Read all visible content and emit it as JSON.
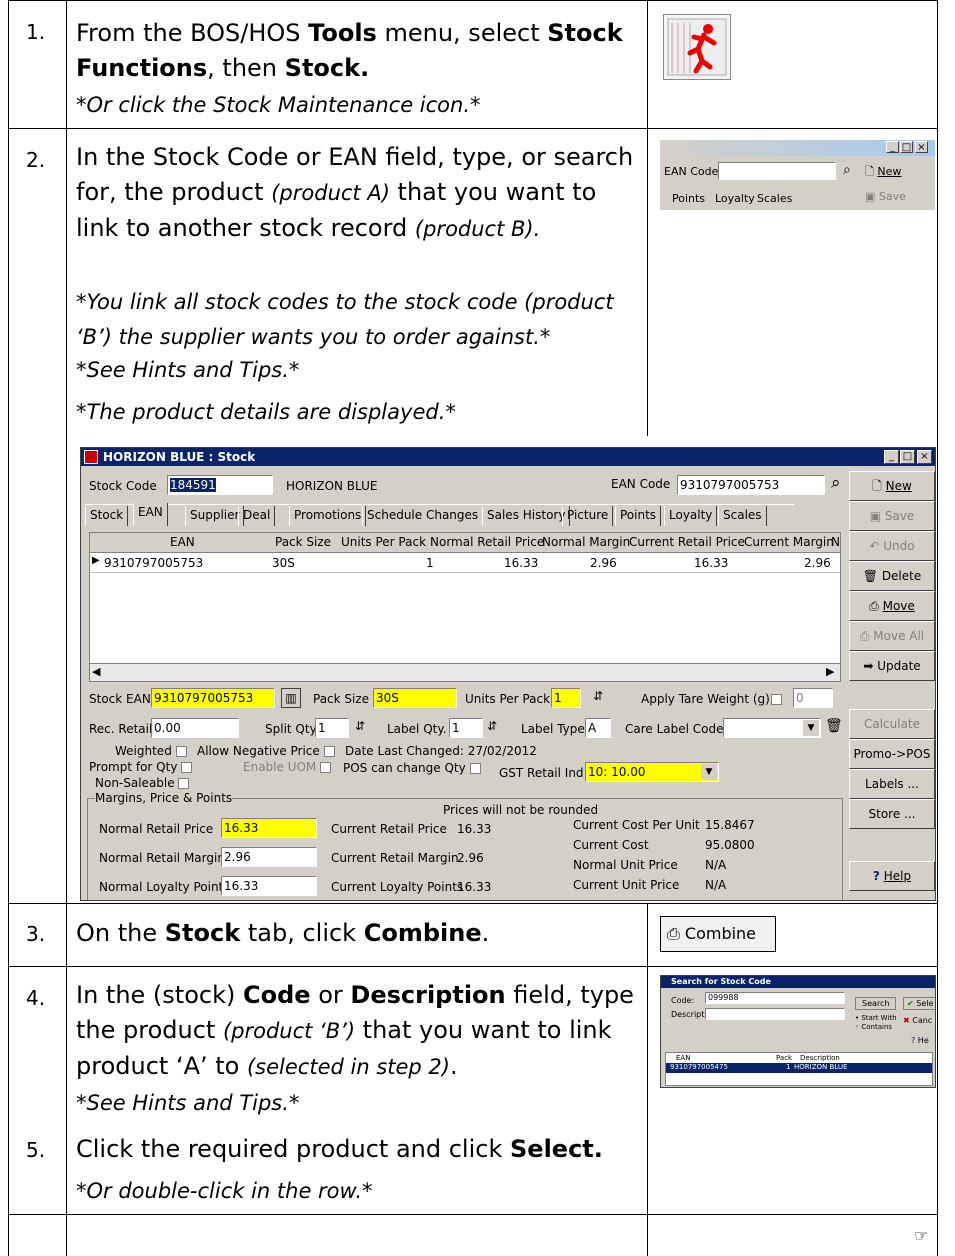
{
  "steps": [
    {
      "num": "1.",
      "lines": [
        "From the BOS/HOS",
        "Tools",
        "menu, select",
        "Stock Functions",
        "then",
        "Stock."
      ],
      "note": "*Or click the Stock Maintenance icon.*"
    },
    {
      "num": "2.",
      "text": "In the Stock Code or EAN field, type, or search for, the product",
      "p1": "(product A)",
      "t2": "that you want to link to another stock record",
      "p2": "(product B).",
      "notes": [
        "*You link all stock codes to the stock code (product ‘B’) the supplier wants you to order against.*",
        "*See Hints and Tips.*",
        "*The product details are displayed.*"
      ]
    },
    {
      "num": "3.",
      "a": "On the",
      "b": "Stock",
      "c": "tab, click",
      "d": "Combine",
      "e": "."
    },
    {
      "num": "4.",
      "a": "In the (stock)",
      "b": "Code",
      "c": "or",
      "d": "Description",
      "e": "field, type the product",
      "f": "(product ‘B’)",
      "g": "that you want to link product ‘A’ to",
      "h": "(selected in step 2)",
      "i": ".",
      "note": "*See Hints and Tips.*"
    },
    {
      "num": "5.",
      "a": "Click the required product and click",
      "b": "Select.",
      "note": "*Or double-click in the row.*"
    }
  ],
  "ean_snip": {
    "label": "EAN Code",
    "new": "New",
    "save": "Save",
    "tabs": [
      "Points",
      "Loyalty",
      "Scales"
    ]
  },
  "stock_window": {
    "title": "HORIZON BLUE : Stock",
    "stock_code_label": "Stock Code",
    "stock_code": "184591",
    "description": "HORIZON BLUE",
    "ean_label": "EAN Code",
    "ean": "9310797005753",
    "tabs": [
      "Stock",
      "EAN",
      "Supplier",
      "Deal",
      "Promotions",
      "Schedule Changes",
      "Sales History",
      "Picture",
      "Points",
      "Loyalty",
      "Scales"
    ],
    "grid_headers": [
      "EAN",
      "Pack Size",
      "Units Per Pack",
      "Normal Retail Price",
      "Normal Margin",
      "Current Retail Price",
      "Current Margin",
      "N"
    ],
    "grid_row": [
      "9310797005753",
      "30S",
      "1",
      "16.33",
      "2.96",
      "16.33",
      "2.96"
    ],
    "side_buttons": [
      "New",
      "Save",
      "Undo",
      "Delete",
      "Move",
      "Move All",
      "Update",
      "Calculate",
      "Promo->POS",
      "Labels ...",
      "Store ...",
      "Help"
    ],
    "stock_ean_label": "Stock EAN",
    "stock_ean": "9310797005753",
    "pack_size_label": "Pack Size",
    "pack_size": "30S",
    "units_per_pack_label": "Units Per Pack",
    "units_per_pack": "1",
    "apply_tare_label": "Apply Tare Weight (g)",
    "apply_tare": "0",
    "rec_retail_label": "Rec. Retail",
    "rec_retail": "0.00",
    "split_qty_label": "Split Qty",
    "split_qty": "1",
    "label_qty_label": "Label Qty.",
    "label_qty": "1",
    "label_type_label": "Label Type",
    "label_type": "A",
    "care_label_label": "Care Label Code",
    "weighted": "Weighted",
    "allow_negative": "Allow Negative Price",
    "date_changed": "Date Last Changed:  27/02/2012",
    "prompt_qty": "Prompt for Qty",
    "enable_uom": "Enable UOM",
    "pos_change": "POS can change Qty",
    "gst_label": "GST Retail Ind",
    "gst": "10: 10.00",
    "non_saleable": "Non-Saleable",
    "group_label": "Margins, Price & Points",
    "not_rounded": "Prices will not be rounded",
    "nrp_label": "Normal Retail Price",
    "nrp": "16.33",
    "crp_label": "Current Retail Price",
    "crp": "16.33",
    "ccpu_label": "Current Cost Per Unit",
    "ccpu": "15.8467",
    "cc_label": "Current Cost",
    "cc": "95.0800",
    "nrm_label": "Normal Retail Margin",
    "nrm": "2.96",
    "crm_label": "Current Retail Margin",
    "crm": "2.96",
    "nup_label": "Normal Unit Price",
    "nup": "N/A",
    "nlp_label": "Normal Loyalty Points",
    "nlp": "16.33",
    "clp_label": "Current Loyalty Points",
    "clp": "16.33",
    "cup_label": "Current Unit Price",
    "cup": "N/A"
  },
  "combine_button": "Combine",
  "search_window": {
    "title": "Search for Stock Code",
    "code_label": "Code:",
    "code": "099988",
    "desc_label": "Description:",
    "search": "Search",
    "select": "Sele",
    "cancel": "Canc",
    "help": "He",
    "start_with": "Start With",
    "contains": "Contains",
    "headers": [
      "EAN",
      "Pack",
      "Description"
    ],
    "row": [
      "9310797005475",
      "1",
      "HORIZON BLUE"
    ]
  }
}
